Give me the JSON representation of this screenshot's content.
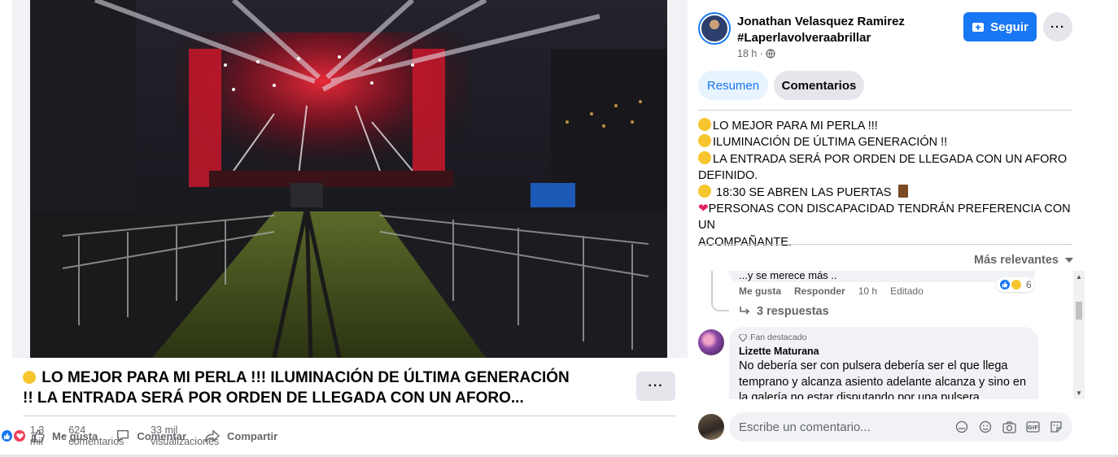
{
  "post": {
    "title_line1": "LO MEJOR PARA MI PERLA !!!  ILUMINACIÓN DE ÚLTIMA GENERACIÓN",
    "title_line2": "!!  LA ENTRADA SERÁ POR ORDEN DE LLEGADA CON UN AFORO...",
    "more_label": "···"
  },
  "actions": {
    "like": "Me gusta",
    "comment": "Comentar",
    "share": "Compartir"
  },
  "stats": {
    "reactions": "1,3 mil",
    "comments": "624 comentarios",
    "separator": "·",
    "views": "33 mil visualizaciones"
  },
  "author": {
    "name": "Jonathan Velasquez Ramirez",
    "tag": "#Laperlavolveraabrillar",
    "time": "18 h ·"
  },
  "header": {
    "follow_label": "Seguir",
    "more_label": "···"
  },
  "tabs": {
    "summary": "Resumen",
    "comments": "Comentarios"
  },
  "description": {
    "line1": "LO MEJOR PARA MI PERLA !!!",
    "line2": "ILUMINACIÓN DE ÚLTIMA GENERACIÓN !!",
    "line3": "LA ENTRADA SERÁ POR ORDEN DE LLEGADA CON UN AFORO",
    "line4": "DEFINIDO.",
    "line5": " 18:30 SE ABREN LAS PUERTAS ",
    "line6": "PERSONAS CON DISCAPACIDAD TENDRÁN PREFERENCIA CON UN",
    "line7": "ACOMPAÑANTE."
  },
  "sort": {
    "label": "Más relevantes"
  },
  "comments": [
    {
      "text_partial": "...y se merece más ..",
      "like": "Me gusta",
      "reply": "Responder",
      "time": "10 h",
      "edited": "Editado",
      "reaction_count": "6",
      "replies": "3 respuestas"
    },
    {
      "badge": "Fan destacado",
      "name": "Lizette Maturana",
      "text": "No debería ser con pulsera debería ser el que llega temprano y alcanza asiento adelante alcanza y sino en la galería no estar disputando por una pulsera"
    }
  ],
  "composer": {
    "placeholder": "Escribe un comentario..."
  },
  "colors": {
    "accent": "#1877f2",
    "secondary_bg": "#e4e6eb",
    "muted_text": "#65676b",
    "love": "#f33e58"
  }
}
